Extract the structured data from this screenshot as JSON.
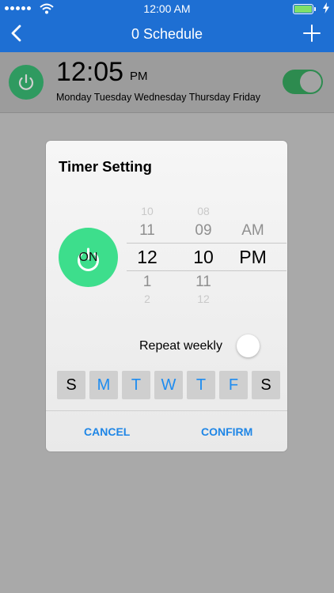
{
  "status_bar": {
    "time": "12:00 AM"
  },
  "nav": {
    "title": "0 Schedule",
    "back_icon": "chevron-left-icon",
    "add_icon": "plus-icon"
  },
  "schedule": {
    "time": "12:05",
    "ampm": "PM",
    "days": "Monday Tuesday Wednesday Thursday Friday",
    "enabled": true
  },
  "dialog": {
    "title": "Timer Setting",
    "power_label": "ON",
    "picker": {
      "hours": [
        "10",
        "11",
        "12",
        "1",
        "2"
      ],
      "minutes": [
        "08",
        "09",
        "10",
        "11",
        "12"
      ],
      "ampm": [
        "AM",
        "PM"
      ]
    },
    "repeat_label": "Repeat weekly",
    "repeat_on": false,
    "days": [
      {
        "label": "S",
        "selected": false
      },
      {
        "label": "M",
        "selected": true
      },
      {
        "label": "T",
        "selected": true
      },
      {
        "label": "W",
        "selected": true
      },
      {
        "label": "T",
        "selected": true
      },
      {
        "label": "F",
        "selected": true
      },
      {
        "label": "S",
        "selected": false
      }
    ],
    "cancel_label": "CANCEL",
    "confirm_label": "CONFIRM"
  },
  "colors": {
    "nav": "#1e6fd3",
    "accent": "#3dde8c",
    "link": "#1f86e6"
  }
}
